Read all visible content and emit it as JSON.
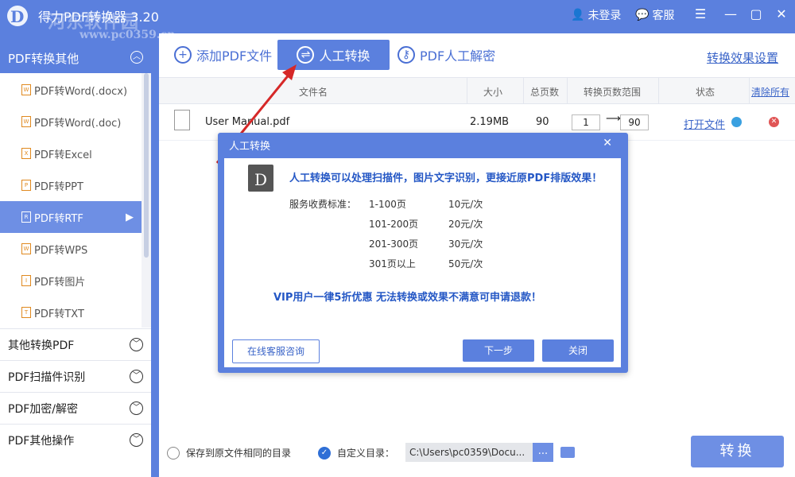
{
  "titlebar": {
    "app_title": "得力PDF转换器 3.20",
    "watermark": "河东软件园",
    "watermark_url": "www.pc0359.cn",
    "login": "未登录",
    "service": "客服"
  },
  "sidebar": {
    "header": "PDF转换其他",
    "sub_items": [
      {
        "label": "PDF转Word(.docx)"
      },
      {
        "label": "PDF转Word(.doc)"
      },
      {
        "label": "PDF转Excel"
      },
      {
        "label": "PDF转PPT"
      },
      {
        "label": "PDF转RTF"
      },
      {
        "label": "PDF转WPS"
      },
      {
        "label": "PDF转图片"
      },
      {
        "label": "PDF转TXT"
      }
    ],
    "active_index": 4,
    "categories": [
      {
        "label": "其他转换PDF"
      },
      {
        "label": "PDF扫描件识别"
      },
      {
        "label": "PDF加密/解密"
      },
      {
        "label": "PDF其他操作"
      }
    ]
  },
  "toolbar": {
    "add_pdf": "添加PDF文件",
    "manual": "人工转换",
    "decrypt": "PDF人工解密",
    "settings": "转换效果设置"
  },
  "table": {
    "headers": {
      "filename": "文件名",
      "size": "大小",
      "pages": "总页数",
      "range": "转换页数范围",
      "status": "状态",
      "clear": "清除所有"
    },
    "rows": [
      {
        "filename": "User Manual.pdf",
        "size": "2.19MB",
        "pages": "90",
        "from": "1",
        "to": "90",
        "open": "打开文件"
      }
    ]
  },
  "bottom": {
    "same_dir": "保存到原文件相同的目录",
    "custom_dir": "自定义目录：",
    "path": "C:\\Users\\pc0359\\Docu...",
    "more": "...",
    "convert": "转换"
  },
  "dialog": {
    "title": "人工转换",
    "headline": "人工转换可以处理扫描件，图片文字识别，更接近原PDF排版效果！",
    "fee_label": "服务收费标准：",
    "fees": [
      {
        "range": "1-100页",
        "price": "10元/次"
      },
      {
        "range": "101-200页",
        "price": "20元/次"
      },
      {
        "range": "201-300页",
        "price": "30元/次"
      },
      {
        "range": "301页以上",
        "price": "50元/次"
      }
    ],
    "vip": "VIP用户一律5折优惠  无法转换或效果不满意可申请退款！",
    "consult": "在线客服咨询",
    "next": "下一步",
    "close": "关闭"
  },
  "colors": {
    "accent": "#5b80de",
    "link": "#3a64c8",
    "delete": "#e05555"
  }
}
